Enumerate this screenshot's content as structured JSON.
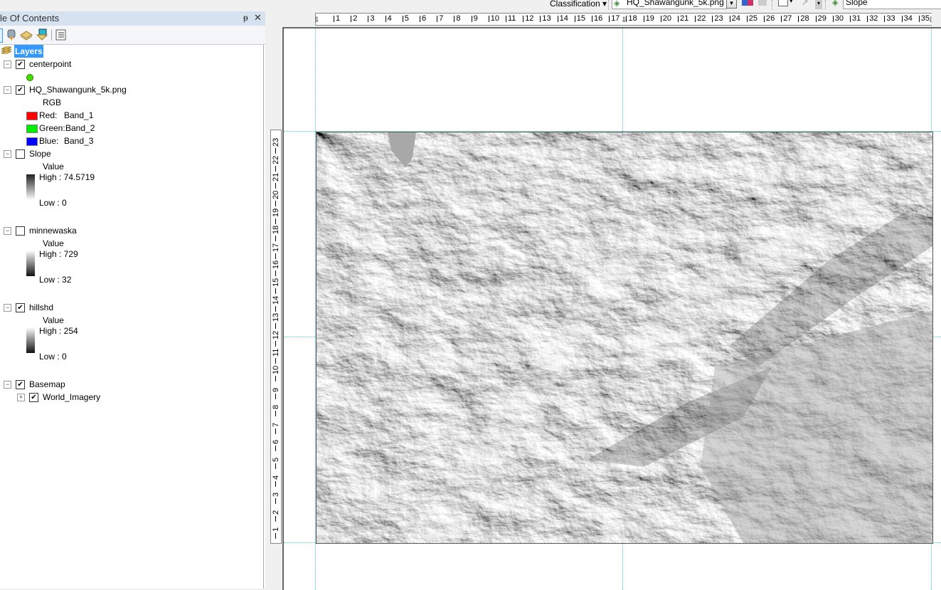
{
  "toolbar": {
    "classification_label": "Classification",
    "layer_combo_value": "HQ_Shawangunk_5k.png",
    "second_layer_value": "Slope",
    "icons": [
      "layer-icon",
      "dropdown-icon",
      "histogram-icon",
      "disabled-icon",
      "rectangle-tool-icon",
      "pointer-icon",
      "overflow-icon"
    ]
  },
  "toc": {
    "title": "le Of Contents",
    "pin_glyph": "ᵽ",
    "close_glyph": "✕",
    "tools": [
      "list-by-drawing-order-icon",
      "list-by-source-icon",
      "list-by-visibility-icon",
      "list-by-selection-icon",
      "options-icon"
    ],
    "root": "Layers",
    "layers": [
      {
        "name": "centerpoint",
        "checked": true,
        "expanded": true,
        "legend": {
          "type": "point",
          "color": "#44dd00"
        }
      },
      {
        "name": "HQ_Shawangunk_5k.png",
        "checked": true,
        "expanded": true,
        "legend": {
          "type": "rgb",
          "heading": "RGB",
          "bands": [
            {
              "label": "Red:",
              "band": "Band_1",
              "color": "#ff0000"
            },
            {
              "label": "Green:",
              "band": "Band_2",
              "color": "#00ee00"
            },
            {
              "label": "Blue:",
              "band": "Band_3",
              "color": "#0000ff"
            }
          ]
        }
      },
      {
        "name": "Slope",
        "checked": false,
        "expanded": true,
        "legend": {
          "type": "stretch",
          "heading": "Value",
          "high": "High : 74.5719",
          "low": "Low : 0",
          "ramp": "dark-to-light"
        }
      },
      {
        "name": "minnewaska",
        "checked": false,
        "expanded": true,
        "legend": {
          "type": "stretch",
          "heading": "Value",
          "high": "High : 729",
          "low": "Low : 32",
          "ramp": "light-to-dark"
        }
      },
      {
        "name": "hillshd",
        "checked": true,
        "expanded": true,
        "legend": {
          "type": "stretch",
          "heading": "Value",
          "high": "High : 254",
          "low": "Low : 0",
          "ramp": "light-to-dark"
        }
      },
      {
        "name": "Basemap",
        "checked": true,
        "expanded": true,
        "children": [
          {
            "name": "World_Imagery",
            "checked": true,
            "expanded": false
          }
        ]
      }
    ]
  },
  "rulers": {
    "horizontal": [
      "1",
      "2",
      "3",
      "4",
      "5",
      "6",
      "7",
      "8",
      "9",
      "10",
      "11",
      "12",
      "13",
      "14",
      "15",
      "16",
      "17",
      "18",
      "19",
      "20",
      "21",
      "22",
      "23",
      "24",
      "25",
      "26",
      "27",
      "28",
      "29",
      "30",
      "31",
      "32",
      "33",
      "34",
      "35"
    ],
    "vertical": [
      "1",
      "2",
      "3",
      "4",
      "5",
      "6",
      "7",
      "8",
      "9",
      "10",
      "11",
      "12",
      "13",
      "14",
      "15",
      "16",
      "17",
      "18",
      "19",
      "20",
      "21",
      "22",
      "23"
    ]
  },
  "map": {
    "description": "Hillshade relief of Shawangunk Ridge area",
    "colors": {
      "guide": "#4dc9c9",
      "selection": "#3399ff"
    }
  }
}
